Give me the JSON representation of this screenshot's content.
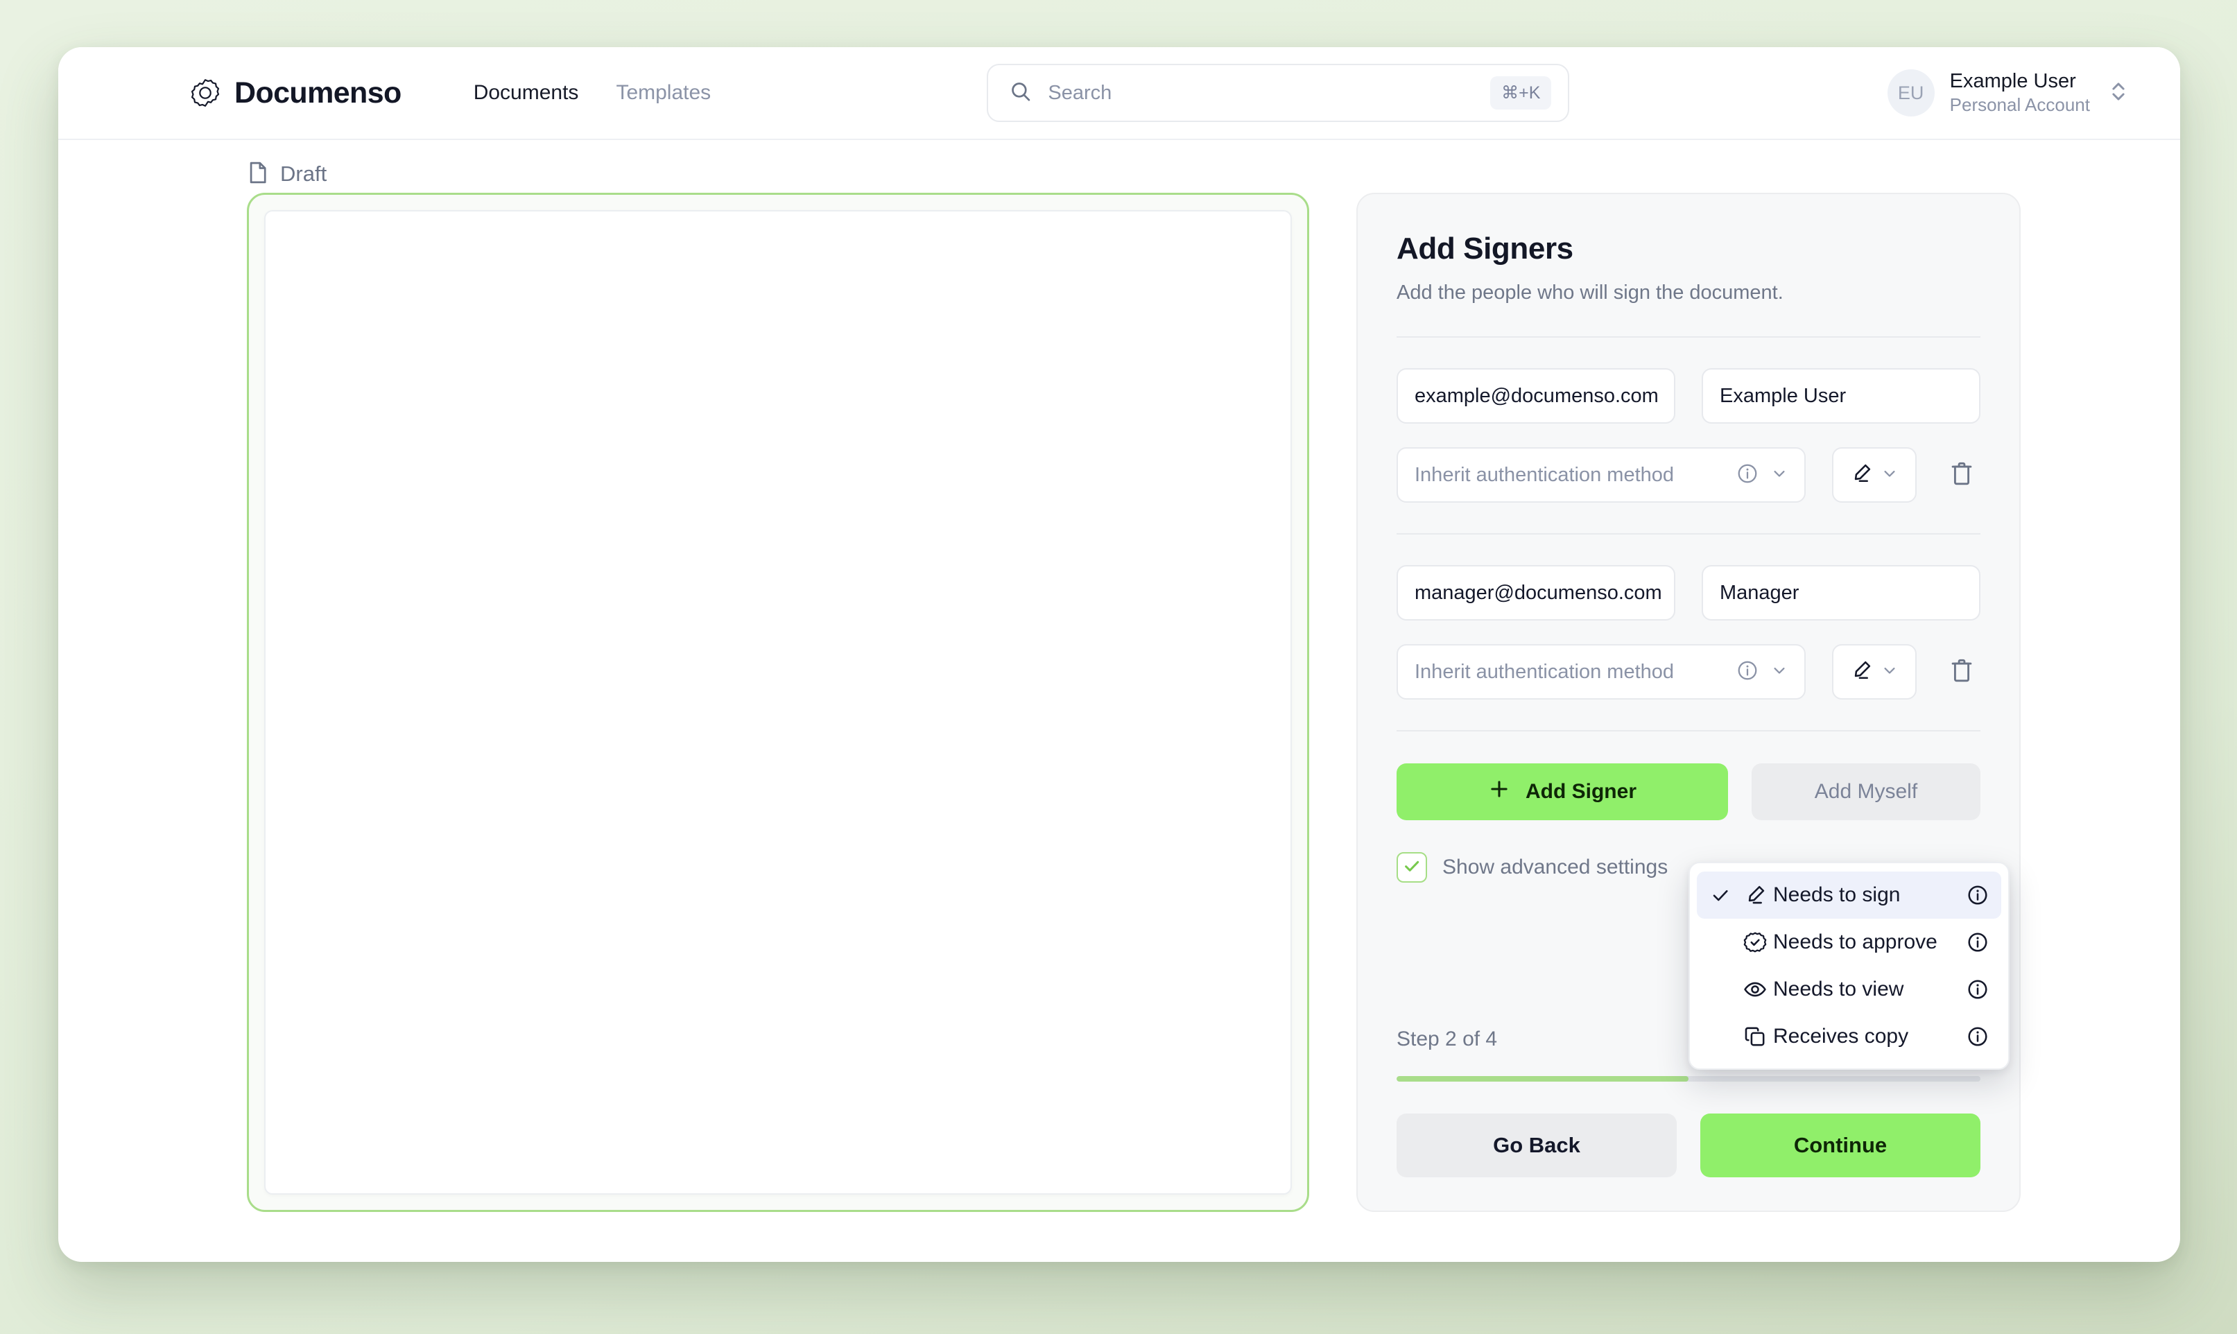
{
  "brand": {
    "name": "Documenso",
    "logo_icon": "documenso-badge-icon"
  },
  "nav": {
    "items": [
      {
        "label": "Documents",
        "active": true
      },
      {
        "label": "Templates",
        "active": false
      }
    ]
  },
  "search": {
    "placeholder": "Search",
    "shortcut": "⌘+K",
    "icon": "search-icon"
  },
  "account": {
    "initials": "EU",
    "name": "Example User",
    "subtitle": "Personal Account",
    "selector_icon": "chevron-up-down-icon"
  },
  "breadcrumb": {
    "icon": "file-icon",
    "label": "Draft"
  },
  "panel": {
    "title": "Add Signers",
    "subtitle": "Add the people who will sign the document.",
    "signers": [
      {
        "email": "example@documenso.com",
        "name": "Example User",
        "auth_method": "Inherit authentication method",
        "role_icon": "pen-icon"
      },
      {
        "email": "manager@documenso.com",
        "name": "Manager",
        "auth_method": "Inherit authentication method",
        "role_icon": "pen-icon"
      }
    ],
    "add_signer_label": "Add Signer",
    "add_myself_label": "Add Myself",
    "advanced_settings_label": "Show advanced settings",
    "advanced_settings_checked": true,
    "step_label": "Step 2 of 4",
    "progress_percent": 50,
    "go_back_label": "Go Back",
    "continue_label": "Continue"
  },
  "role_menu": {
    "items": [
      {
        "label": "Needs to sign",
        "icon": "pen-icon",
        "selected": true
      },
      {
        "label": "Needs to approve",
        "icon": "badge-check-icon",
        "selected": false
      },
      {
        "label": "Needs to view",
        "icon": "eye-icon",
        "selected": false
      },
      {
        "label": "Receives copy",
        "icon": "copy-icon",
        "selected": false
      }
    ]
  },
  "colors": {
    "accent_green": "#90ef6a",
    "accent_green_soft": "#a9dd8a",
    "page_background": "#e6f0de",
    "menu_selected": "#eef1fb",
    "text_dark": "#14182a",
    "text_muted": "#6f7789"
  }
}
